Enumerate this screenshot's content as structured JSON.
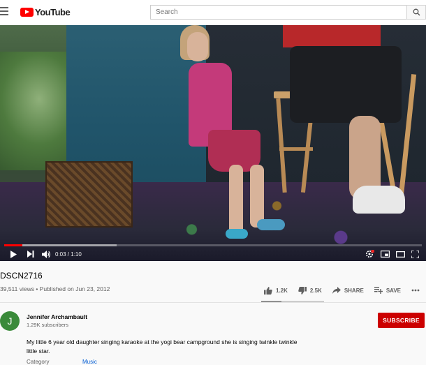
{
  "header": {
    "logo_text": "YouTube",
    "search_placeholder": "Search"
  },
  "player": {
    "time": "0:03 / 1:10",
    "progress_fraction": 0.043,
    "buffered_fraction": 0.27
  },
  "video": {
    "title": "DSCN2716",
    "views_line": "39,511 views • Published on Jun 23, 2012"
  },
  "actions": {
    "likes": "1.2K",
    "dislikes": "2.5K",
    "share": "SHARE",
    "save": "SAVE",
    "like_ratio": 0.32
  },
  "channel": {
    "avatar_letter": "J",
    "name": "Jennifer Archambault",
    "subscribers": "1.29K subscribers",
    "subscribe_label": "SUBSCRIBE"
  },
  "description": "My little 6 year old daughter singing karaoke at the yogi bear campground she is singing twinkle twinkle little star.",
  "meta": {
    "category_label": "Category",
    "category_value": "Music"
  },
  "colors": {
    "brand_red": "#ff0000",
    "subscribe_red": "#cc0000",
    "avatar_green": "#3a8a3a"
  }
}
